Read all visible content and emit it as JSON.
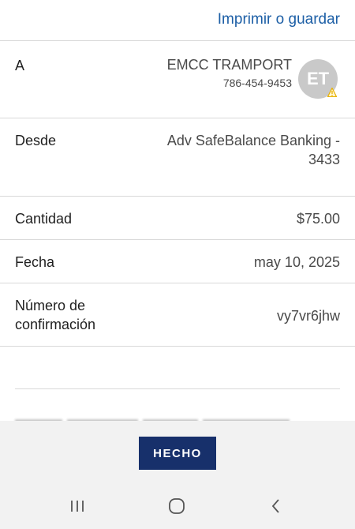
{
  "header": {
    "print_label": "Imprimir o guardar"
  },
  "details": {
    "to": {
      "label": "A",
      "name": "EMCC TRAMPORT",
      "phone": "786-454-9453",
      "initials": "ET"
    },
    "from": {
      "label": "Desde",
      "account_line1": "Adv SafeBalance Banking -",
      "account_line2": "3433"
    },
    "amount": {
      "label": "Cantidad",
      "value": "$75.00"
    },
    "date": {
      "label": "Fecha",
      "value": "may 10, 2025"
    },
    "confirmation": {
      "label_line1": "Número de",
      "label_line2": "confirmación",
      "value": "vy7vr6jhw"
    }
  },
  "footer": {
    "done_label": "HECHO"
  },
  "navbar": {
    "icons": [
      "recent-apps-icon",
      "home-icon",
      "back-icon"
    ]
  },
  "colors": {
    "accent_link": "#1d5fa6",
    "button_bg": "#17306b",
    "avatar_bg": "#c9c9c9",
    "warning": "#e8b100"
  }
}
